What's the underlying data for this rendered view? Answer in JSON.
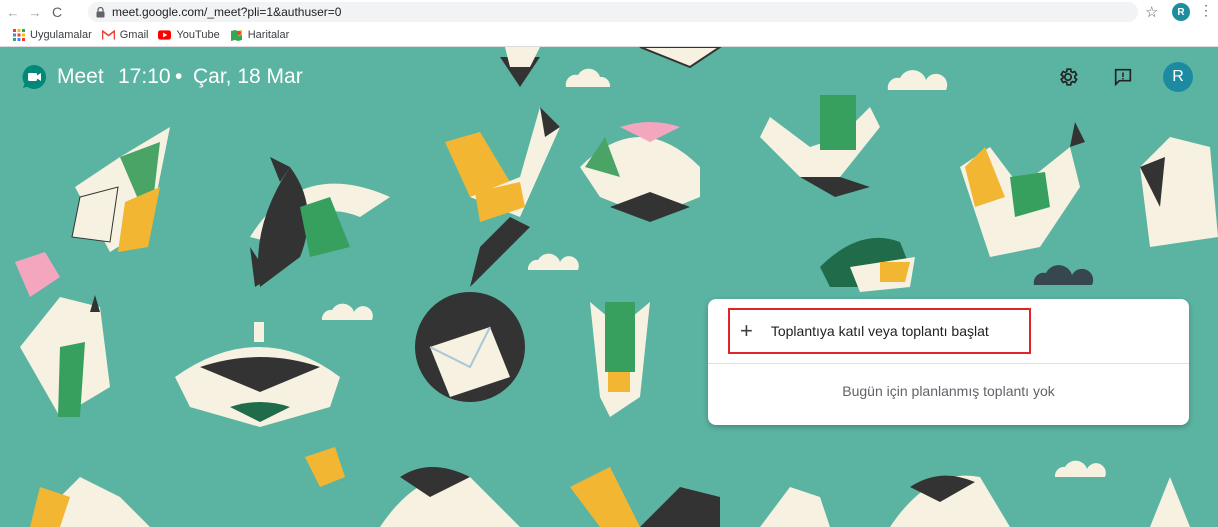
{
  "browser": {
    "url": "meet.google.com/_meet?pli=1&authuser=0",
    "profile_initial": "R",
    "bookmarks": [
      {
        "label": "Uygulamalar",
        "icon": "apps-grid-icon"
      },
      {
        "label": "Gmail",
        "icon": "gmail-icon"
      },
      {
        "label": "YouTube",
        "icon": "youtube-icon"
      },
      {
        "label": "Haritalar",
        "icon": "maps-icon"
      }
    ]
  },
  "meet": {
    "title": "Meet",
    "time": "17:10",
    "separator": "•",
    "date": "Çar, 18 Mar",
    "avatar_initial": "R",
    "background_color": "#5bb4a2",
    "accent": "#00897b"
  },
  "card": {
    "join_label": "Toplantıya katıl veya toplantı başlat",
    "join_icon": "plus-icon",
    "empty_text": "Bugün için planlanmış toplantı yok",
    "highlight_color": "#e0242b"
  }
}
